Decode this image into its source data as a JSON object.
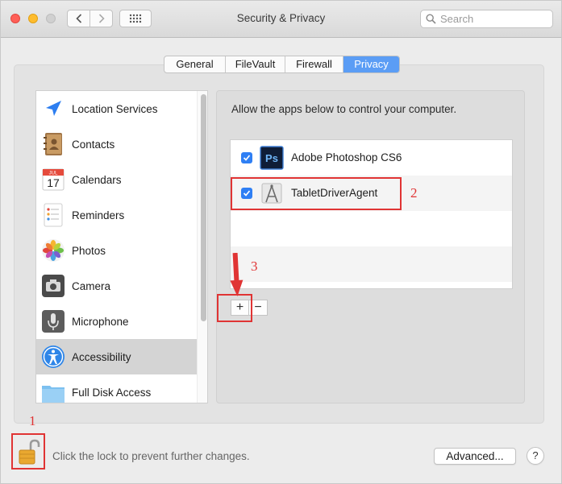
{
  "window": {
    "title": "Security & Privacy",
    "search_placeholder": "Search"
  },
  "tabs": [
    {
      "label": "General",
      "active": false
    },
    {
      "label": "FileVault",
      "active": false
    },
    {
      "label": "Firewall",
      "active": false
    },
    {
      "label": "Privacy",
      "active": true
    }
  ],
  "sidebar": {
    "items": [
      {
        "label": "Location Services",
        "icon": "location-arrow-icon",
        "selected": false
      },
      {
        "label": "Contacts",
        "icon": "contacts-book-icon",
        "selected": false
      },
      {
        "label": "Calendars",
        "icon": "calendar-icon",
        "selected": false,
        "icon_text": {
          "month": "JUL",
          "day": "17"
        }
      },
      {
        "label": "Reminders",
        "icon": "reminders-list-icon",
        "selected": false
      },
      {
        "label": "Photos",
        "icon": "photos-flower-icon",
        "selected": false
      },
      {
        "label": "Camera",
        "icon": "camera-icon",
        "selected": false
      },
      {
        "label": "Microphone",
        "icon": "microphone-icon",
        "selected": false
      },
      {
        "label": "Accessibility",
        "icon": "accessibility-icon",
        "selected": true
      },
      {
        "label": "Full Disk Access",
        "icon": "folder-icon",
        "selected": false
      }
    ]
  },
  "main": {
    "description": "Allow the apps below to control your computer.",
    "apps": [
      {
        "name": "Adobe Photoshop CS6",
        "checked": true,
        "icon": "photoshop-icon",
        "icon_text": "Ps"
      },
      {
        "name": "TabletDriverAgent",
        "checked": true,
        "icon": "tablet-driver-icon"
      }
    ],
    "add_label": "+",
    "remove_label": "−"
  },
  "annotations": {
    "labels": [
      "1",
      "2",
      "3"
    ],
    "color": "#e03434"
  },
  "footer": {
    "lock_text": "Click the lock to prevent further changes.",
    "advanced_label": "Advanced...",
    "help_label": "?"
  },
  "colors": {
    "accent": "#5b9df5",
    "checkbox": "#2f7ff4",
    "selection": "#d4d4d4"
  }
}
